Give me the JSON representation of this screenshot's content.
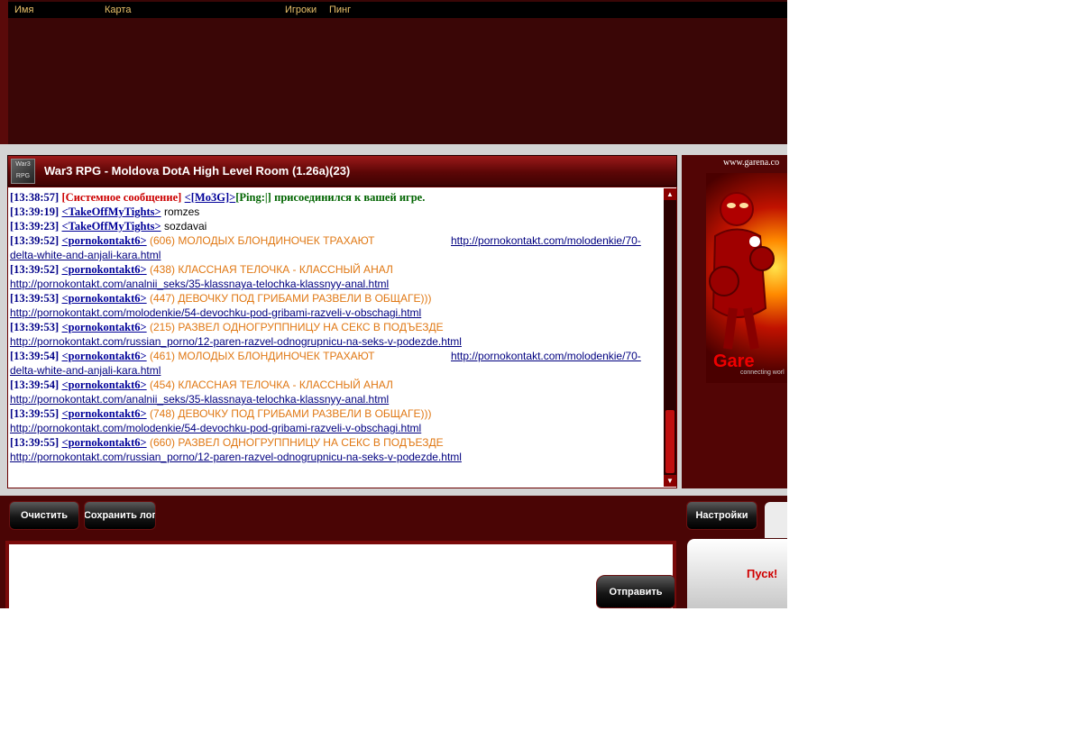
{
  "game_list": {
    "columns": [
      "Имя",
      "Карта",
      "Игроки",
      "Пинг"
    ]
  },
  "room": {
    "icon_top": "War3",
    "icon_bottom": "RPG",
    "title": "War3 RPG -  Moldova DotA High Level Room (1.26a)(23)"
  },
  "chat": {
    "l1": {
      "ts": "[13:38:57]",
      "sys": "[Системное сообщение]",
      "user": "<[Mo3G]>",
      "ping": "[Ping:|]",
      "msg": "присоединился к вашей игре."
    },
    "l2": {
      "ts": "[13:39:19]",
      "user": "<TakeOffMyTights>",
      "msg": "romzes"
    },
    "l3": {
      "ts": "[13:39:23]",
      "user": "<TakeOffMyTights>",
      "msg": "sozdavai"
    },
    "l4": {
      "ts": "[13:39:52]",
      "user": "<pornokontakt6>",
      "msg": "(606) МОЛОДЫХ БЛОНДИНОЧЕК ТРАХАЮТ",
      "url": "http://pornokontakt.com/molodenkie/70-",
      "url2": "delta-white-and-anjali-kara.html"
    },
    "l5": {
      "ts": "[13:39:52]",
      "user": "<pornokontakt6>",
      "msg": "(438) КЛАССНАЯ ТЕЛОЧКА - КЛАССНЫЙ АНАЛ",
      "url": "http://pornokontakt.com/analnii_seks/35-klassnaya-telochka-klassnyy-anal.html"
    },
    "l6": {
      "ts": "[13:39:53]",
      "user": "<pornokontakt6>",
      "msg": "(447) ДЕВОЧКУ ПОД ГРИБАМИ РАЗВЕЛИ В ОБЩАГЕ)))",
      "url": "http://pornokontakt.com/molodenkie/54-devochku-pod-gribami-razveli-v-obschagi.html"
    },
    "l7": {
      "ts": "[13:39:53]",
      "user": "<pornokontakt6>",
      "msg": "(215) РАЗВЕЛ ОДНОГРУППНИЦУ НА СЕКС В ПОДЪЕЗДЕ",
      "url": "http://pornokontakt.com/russian_porno/12-paren-razvel-odnogrupnicu-na-seks-v-podezde.html"
    },
    "l8": {
      "ts": "[13:39:54]",
      "user": "<pornokontakt6>",
      "msg": "(461) МОЛОДЫХ БЛОНДИНОЧЕК ТРАХАЮТ",
      "url": "http://pornokontakt.com/molodenkie/70-",
      "url2": "delta-white-and-anjali-kara.html"
    },
    "l9": {
      "ts": "[13:39:54]",
      "user": "<pornokontakt6>",
      "msg": "(454) КЛАССНАЯ ТЕЛОЧКА - КЛАССНЫЙ АНАЛ",
      "url": "http://pornokontakt.com/analnii_seks/35-klassnaya-telochka-klassnyy-anal.html"
    },
    "l10": {
      "ts": "[13:39:55]",
      "user": "<pornokontakt6>",
      "msg": "(748) ДЕВОЧКУ ПОД ГРИБАМИ РАЗВЕЛИ В ОБЩАГЕ)))",
      "url": "http://pornokontakt.com/molodenkie/54-devochku-pod-gribami-razveli-v-obschagi.html"
    },
    "l11": {
      "ts": "[13:39:55]",
      "user": "<pornokontakt6>",
      "msg": "(660) РАЗВЕЛ ОДНОГРУППНИЦУ НА СЕКС В ПОДЪЕЗДЕ",
      "url": "http://pornokontakt.com/russian_porno/12-paren-razvel-odnogrupnicu-na-seks-v-podezde.html"
    }
  },
  "ad": {
    "url": "www.garena.co",
    "brand": "Gare",
    "tagline": "connecting worl"
  },
  "buttons": {
    "clear": "Очистить",
    "save_log": "Сохранить лог",
    "settings": "Настройки",
    "send": "Отправить",
    "start": "Пуск!"
  },
  "colors": {
    "panel_dark": "#3a0606",
    "accent_red": "#9c1a1a",
    "timestamp": "#000088",
    "system": "#cc0000",
    "spam": "#e07814"
  }
}
